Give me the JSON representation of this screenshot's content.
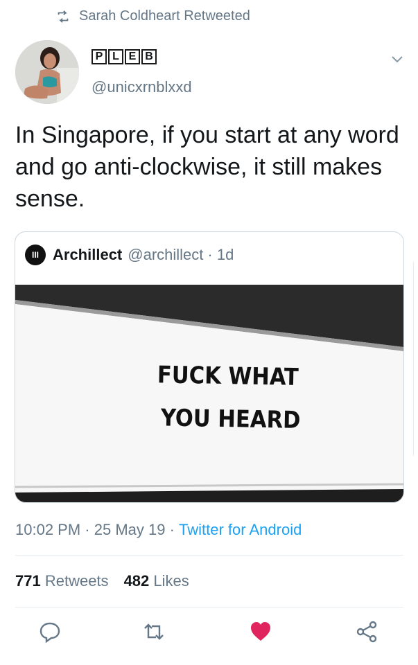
{
  "retweet_banner": {
    "text": "Sarah Coldheart Retweeted",
    "icon": "retweet-icon"
  },
  "author": {
    "display_name_letters": [
      "P",
      "L",
      "E",
      "B"
    ],
    "handle": "@unicxrnblxxd"
  },
  "tweet": {
    "text": "In Singapore, if you start at any word and go anti-clockwise, it still makes sense."
  },
  "quoted": {
    "avatar_label": "III",
    "name": "Archillect",
    "handle": "@archillect",
    "age": "· 1d",
    "image_text_line1": "FUCK WHAT",
    "image_text_line2": "YOU HEARD"
  },
  "meta": {
    "time": "10:02 PM",
    "sep1": " · ",
    "date": "25 May 19",
    "sep2": " · ",
    "source": "Twitter for Android"
  },
  "stats": {
    "retweets_count": "771",
    "retweets_label": "Retweets",
    "likes_count": "482",
    "likes_label": "Likes"
  },
  "actions": [
    "reply-icon",
    "retweet-icon",
    "like-icon",
    "share-icon"
  ],
  "colors": {
    "accent": "#1da1f2",
    "like": "#e0245e",
    "muted": "#657786",
    "text": "#14171a"
  }
}
